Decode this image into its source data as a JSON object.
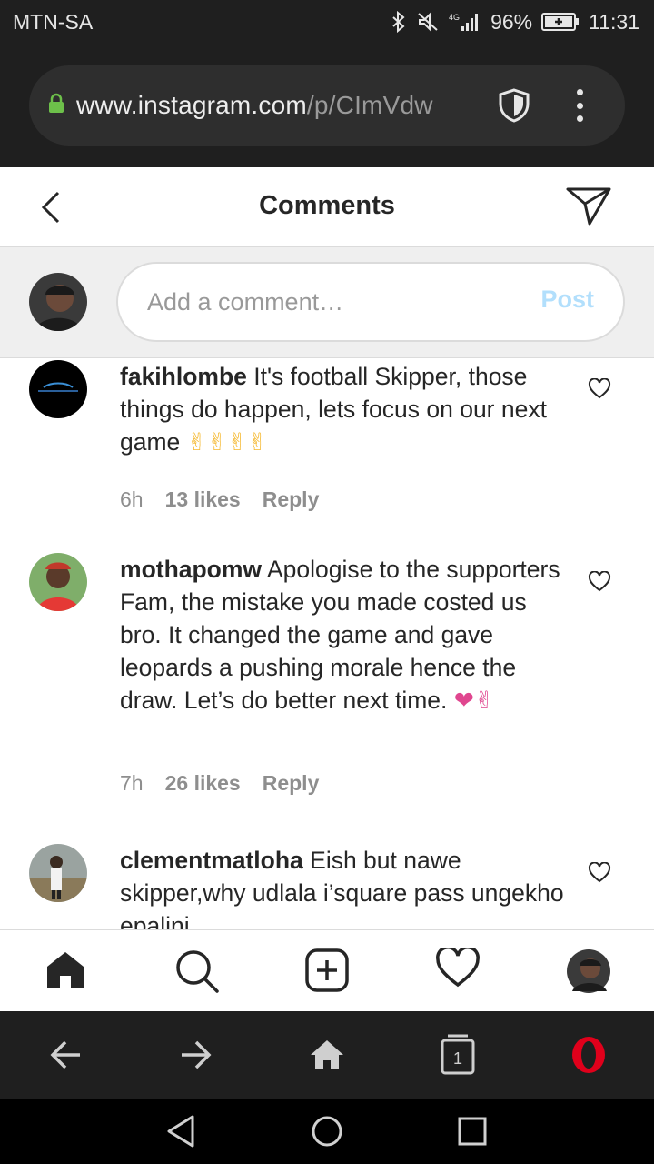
{
  "status_bar": {
    "carrier": "MTN-SA",
    "network": "4G",
    "battery": "96%",
    "time": "11:31"
  },
  "browser": {
    "url_host": "www.instagram.com",
    "url_path": "/p/CImVdw",
    "icons": [
      "lock-icon",
      "shield-icon",
      "more-vert-icon"
    ]
  },
  "header": {
    "title": "Comments",
    "icons": [
      "back-arrow-icon",
      "send-direct-icon"
    ]
  },
  "add_comment": {
    "placeholder": "Add a comment…",
    "post_label": "Post"
  },
  "comments": [
    {
      "username": "fakihlombe",
      "text": "It's football Skipper, those things do happen, lets focus on our next game",
      "emoji": "✌✌✌✌",
      "time": "6h",
      "likes": "13 likes",
      "reply": "Reply"
    },
    {
      "username": "mothapomw",
      "text": "Apologise to the supporters Fam, the mistake you made costed us bro. It changed the game and gave leopards a pushing morale hence the draw. Let’s do better next time.",
      "emoji": "❤✌",
      "time": "7h",
      "likes": "26 likes",
      "reply": "Reply"
    },
    {
      "username": "clementmatloha",
      "text": "Eish but nawe skipper,why udlala i’square pass ungekho epalini",
      "emoji": "",
      "time": "",
      "likes": "",
      "reply": ""
    }
  ],
  "bottom_nav": {
    "icons": [
      "home-icon",
      "search-icon",
      "new-post-icon",
      "activity-heart-icon",
      "profile-avatar"
    ]
  },
  "browser_bottom": {
    "tab_count": "1",
    "icons": [
      "back-icon",
      "forward-icon",
      "home-icon",
      "tabs-icon",
      "opera-icon"
    ]
  },
  "colors": {
    "status_bg": "#1f1f1f",
    "url_pill": "#2e2e2e",
    "lock": "#6dc04a",
    "post_disabled": "#b2dffc",
    "heart_pink": "#e0468f",
    "emoji_yellow": "#f5b82e",
    "opera_red": "#e0001b"
  }
}
